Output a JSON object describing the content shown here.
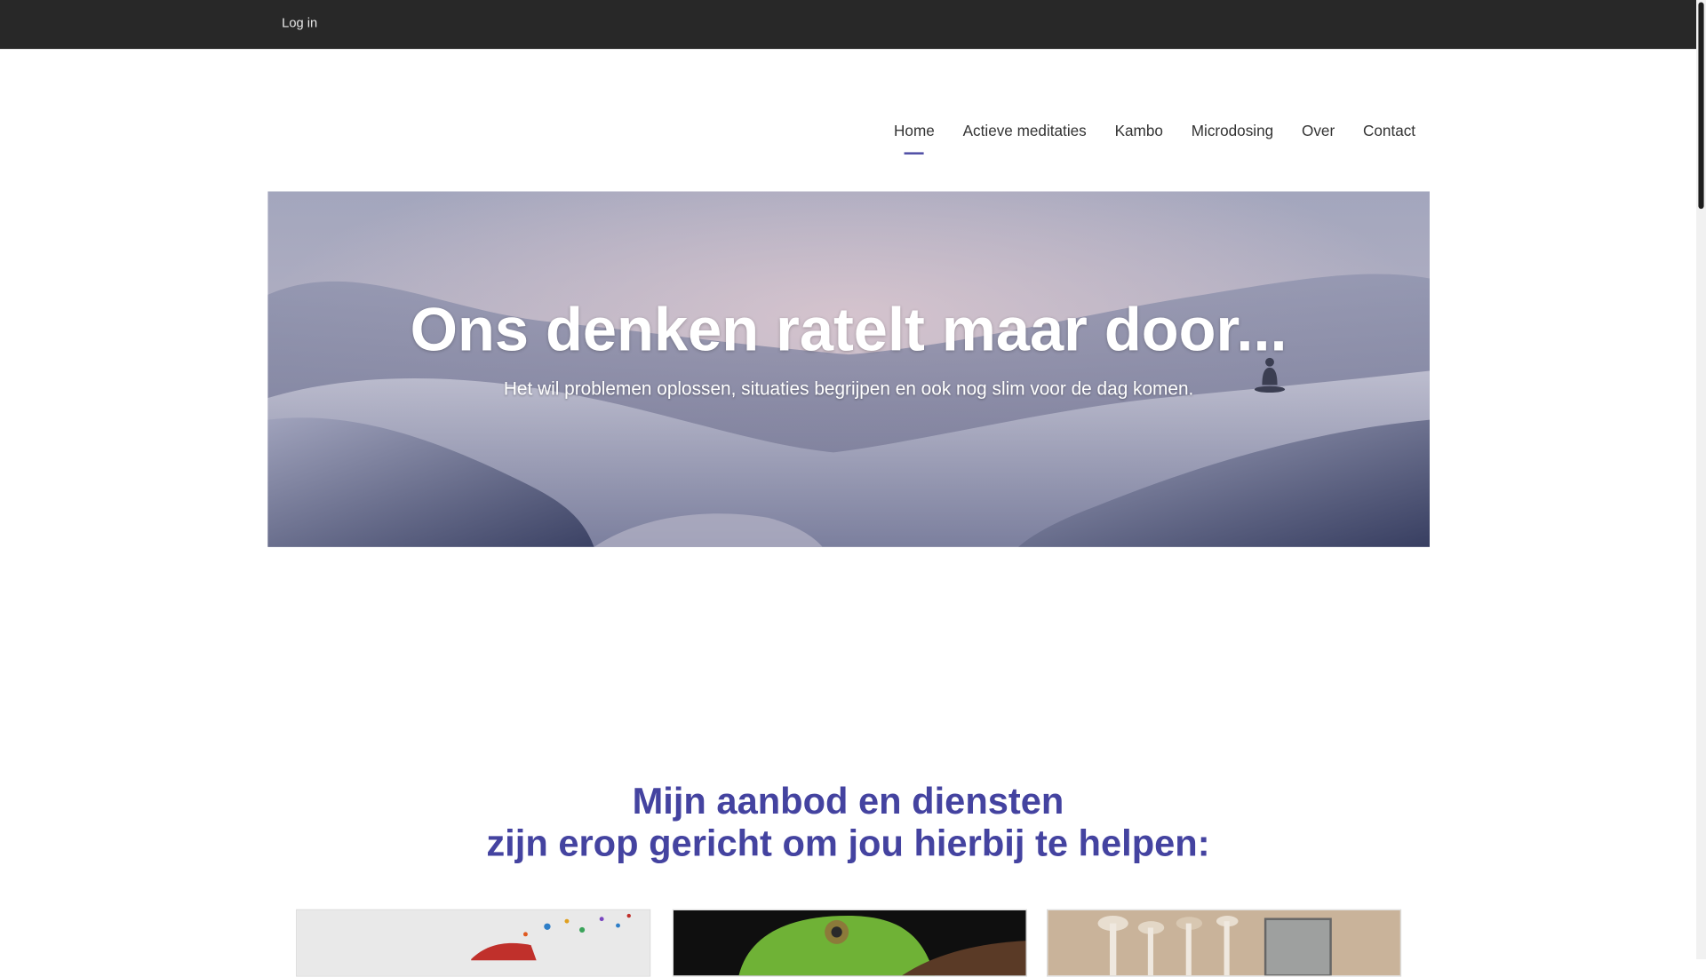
{
  "topbar": {
    "login_label": "Log in"
  },
  "nav": {
    "items": [
      {
        "label": "Home",
        "active": true
      },
      {
        "label": "Actieve meditaties"
      },
      {
        "label": "Kambo"
      },
      {
        "label": "Microdosing"
      },
      {
        "label": "Over"
      },
      {
        "label": "Contact"
      }
    ]
  },
  "hero": {
    "title": "Ons denken ratelt maar door...",
    "subtitle": "Het wil problemen oplossen, situaties begrijpen en ook nog slim voor de dag komen."
  },
  "services": {
    "heading_line1": "Mijn aanbod en diensten",
    "heading_line2": "zijn erop gericht om jou hierbij te helpen:"
  },
  "colors": {
    "accent": "#4443a0",
    "topbar": "#282828"
  }
}
